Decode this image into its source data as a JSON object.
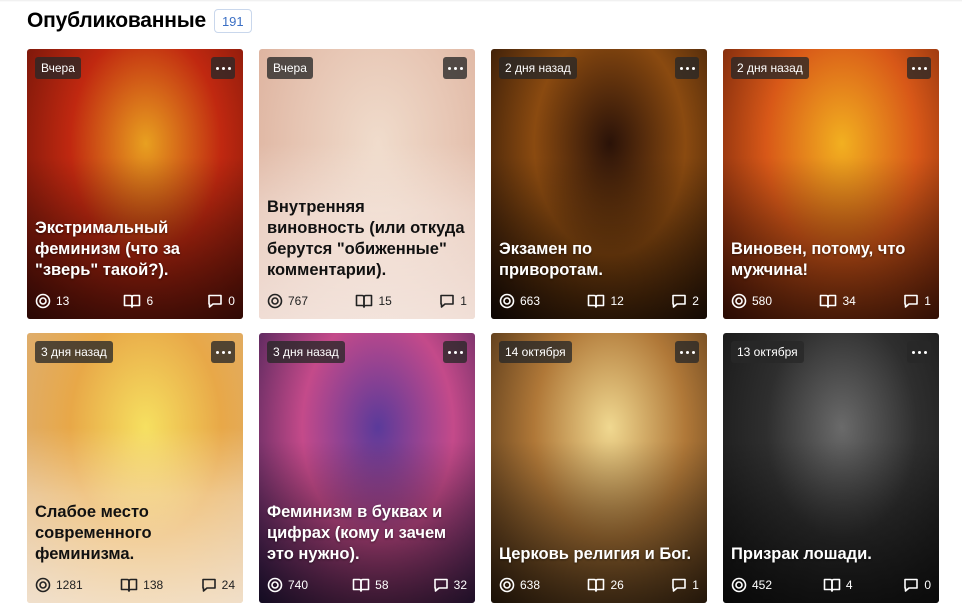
{
  "header": {
    "title": "Опубликованные",
    "count": "191"
  },
  "icons": {
    "views": "views-icon",
    "reads": "book-icon",
    "comments": "comment-icon",
    "more": "more-dots-icon"
  },
  "cards": [
    {
      "date": "Вчера",
      "title": "Экстримальный феминизм (что за \"зверь\" такой?).",
      "views": "13",
      "reads": "6",
      "comments": "0",
      "theme": "dark",
      "colors": [
        "#e8a020",
        "#c02810",
        "#5a1008"
      ]
    },
    {
      "date": "Вчера",
      "title": "Внутренняя виновность (или откуда берутся \"обиженные\" комментарии).",
      "views": "767",
      "reads": "15",
      "comments": "1",
      "theme": "light",
      "colors": [
        "#f0dccc",
        "#e7c6b4",
        "#d9aa95"
      ]
    },
    {
      "date": "2 дня назад",
      "title": "Экзамен по приворотам.",
      "views": "663",
      "reads": "12",
      "comments": "2",
      "theme": "dark",
      "colors": [
        "#2a1208",
        "#8a4a10",
        "#1a0c06"
      ]
    },
    {
      "date": "2 дня назад",
      "title": "Виновен, потому, что мужчина!",
      "views": "580",
      "reads": "34",
      "comments": "1",
      "theme": "dark",
      "colors": [
        "#f2b020",
        "#d85818",
        "#5a1808"
      ]
    },
    {
      "date": "3 дня назад",
      "title": "Слабое место современного феминизма.",
      "views": "1281",
      "reads": "138",
      "comments": "24",
      "theme": "light",
      "colors": [
        "#f6e060",
        "#e8a848",
        "#d9b080"
      ]
    },
    {
      "date": "3 дня назад",
      "title": "Феминизм в буквах и цифрах (кому и зачем это нужно).",
      "views": "740",
      "reads": "58",
      "comments": "32",
      "theme": "dark",
      "colors": [
        "#5a3a9a",
        "#c44a8a",
        "#2a1a4a"
      ]
    },
    {
      "date": "14 октября",
      "title": "Церковь религия и Бог.",
      "views": "638",
      "reads": "26",
      "comments": "1",
      "theme": "dark",
      "colors": [
        "#f0d890",
        "#b07838",
        "#3a2410"
      ]
    },
    {
      "date": "13 октября",
      "title": "Призрак лошади.",
      "views": "452",
      "reads": "4",
      "comments": "0",
      "theme": "dark",
      "colors": [
        "#6a6a6a",
        "#2e2e2e",
        "#121212"
      ]
    }
  ]
}
